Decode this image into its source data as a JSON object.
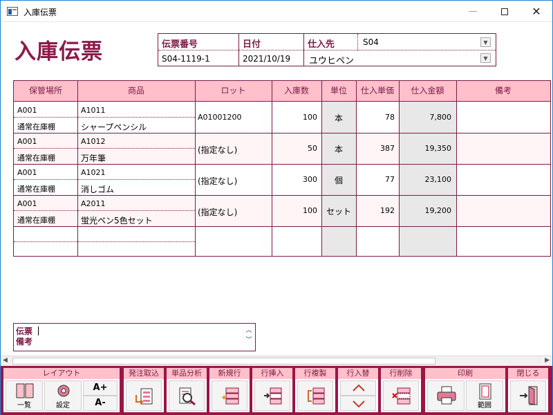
{
  "window": {
    "title": "入庫伝票"
  },
  "heading": "入庫伝票",
  "header": {
    "slip_no_label": "伝票番号",
    "slip_no": "S04-1119-1",
    "date_label": "日付",
    "date": "2021/10/19",
    "supplier_label": "仕入先",
    "supplier_code": "S04",
    "supplier_name": "ユウヒペン"
  },
  "table": {
    "columns": [
      "保管場所",
      "商品",
      "ロット",
      "入庫数",
      "単位",
      "仕入単価",
      "仕入金額",
      "備考"
    ],
    "rows": [
      {
        "loc_code": "A001",
        "loc_name": "通常在庫棚",
        "item_code": "A1011",
        "item_name": "シャープペンシル",
        "lot": "A01001200",
        "qty": "100",
        "unit": "本",
        "unit_price": "78",
        "amount": "7,800",
        "note": ""
      },
      {
        "loc_code": "A001",
        "loc_name": "通常在庫棚",
        "item_code": "A1012",
        "item_name": "万年筆",
        "lot": "(指定なし)",
        "qty": "50",
        "unit": "本",
        "unit_price": "387",
        "amount": "19,350",
        "note": ""
      },
      {
        "loc_code": "A001",
        "loc_name": "通常在庫棚",
        "item_code": "A1021",
        "item_name": "消しゴム",
        "lot": "(指定なし)",
        "qty": "300",
        "unit": "個",
        "unit_price": "77",
        "amount": "23,100",
        "note": ""
      },
      {
        "loc_code": "A001",
        "loc_name": "通常在庫棚",
        "item_code": "A2011",
        "item_name": "蛍光ペン5色セット",
        "lot": "(指定なし)",
        "qty": "100",
        "unit": "セット",
        "unit_price": "192",
        "amount": "19,200",
        "note": ""
      }
    ]
  },
  "memo": {
    "label": "伝票\n備考",
    "value": ""
  },
  "toolbar": {
    "layout": {
      "label": "レイアウト",
      "list": "一覧",
      "settings": "設定",
      "font_up": "A+",
      "font_down": "A-"
    },
    "order_import": "発注取込",
    "item_analysis": "単品分析",
    "new_row": "新規行",
    "insert_row": "行挿入",
    "copy_row": "行複製",
    "swap_row": "行入替",
    "delete_row": "行削除",
    "print": {
      "label": "印刷",
      "range": "範囲"
    },
    "close": "閉じる"
  },
  "colors": {
    "accent": "#7a1a46",
    "header_bg": "#ffc0cb",
    "toolbar_bg": "#9c1547"
  }
}
